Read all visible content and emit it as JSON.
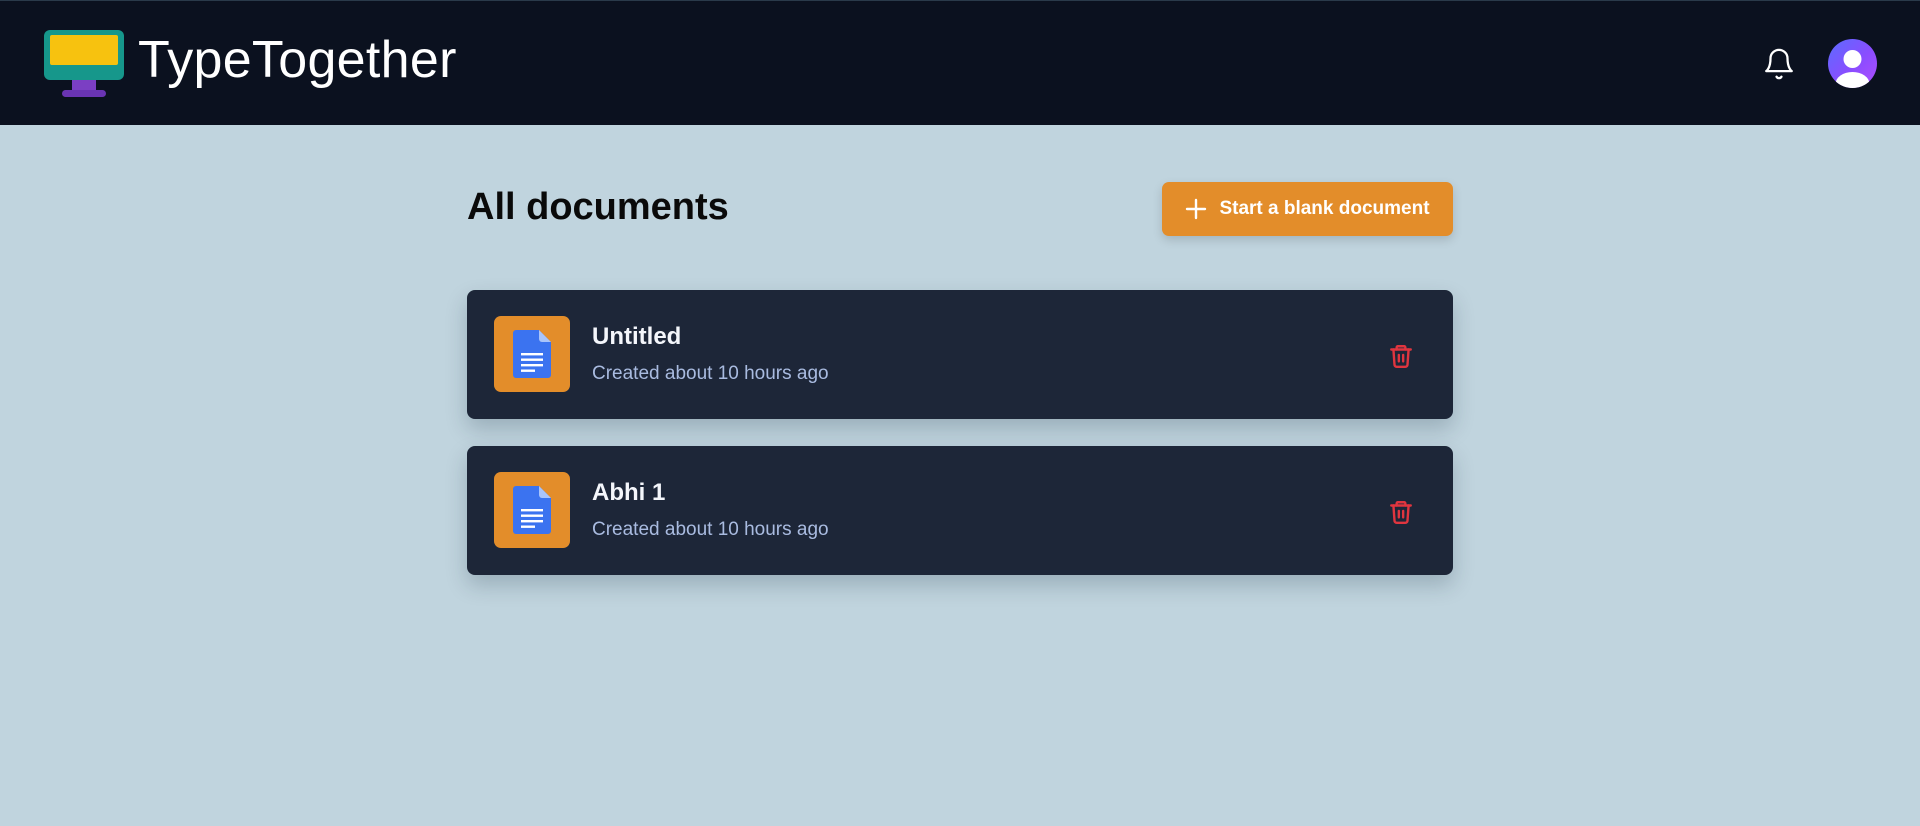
{
  "header": {
    "app_title": "TypeTogether",
    "logo_icon": "monitor-logo-icon",
    "notifications_icon": "bell-icon",
    "avatar_icon": "user-avatar-icon"
  },
  "main": {
    "title": "All documents",
    "new_button": {
      "label": "Start a blank document",
      "icon": "plus-icon"
    },
    "documents": [
      {
        "name": "Untitled",
        "meta": "Created about 10 hours ago",
        "icon": "document-icon",
        "action_icon": "trash-icon"
      },
      {
        "name": "Abhi 1",
        "meta": "Created about 10 hours ago",
        "icon": "document-icon",
        "action_icon": "trash-icon"
      }
    ]
  },
  "colors": {
    "topbar": "#0b111f",
    "background": "#c0d4de",
    "accent": "#e38d2a",
    "card": "#1d2638",
    "delete": "#e0353f",
    "doc_blue": "#3b73f0"
  }
}
